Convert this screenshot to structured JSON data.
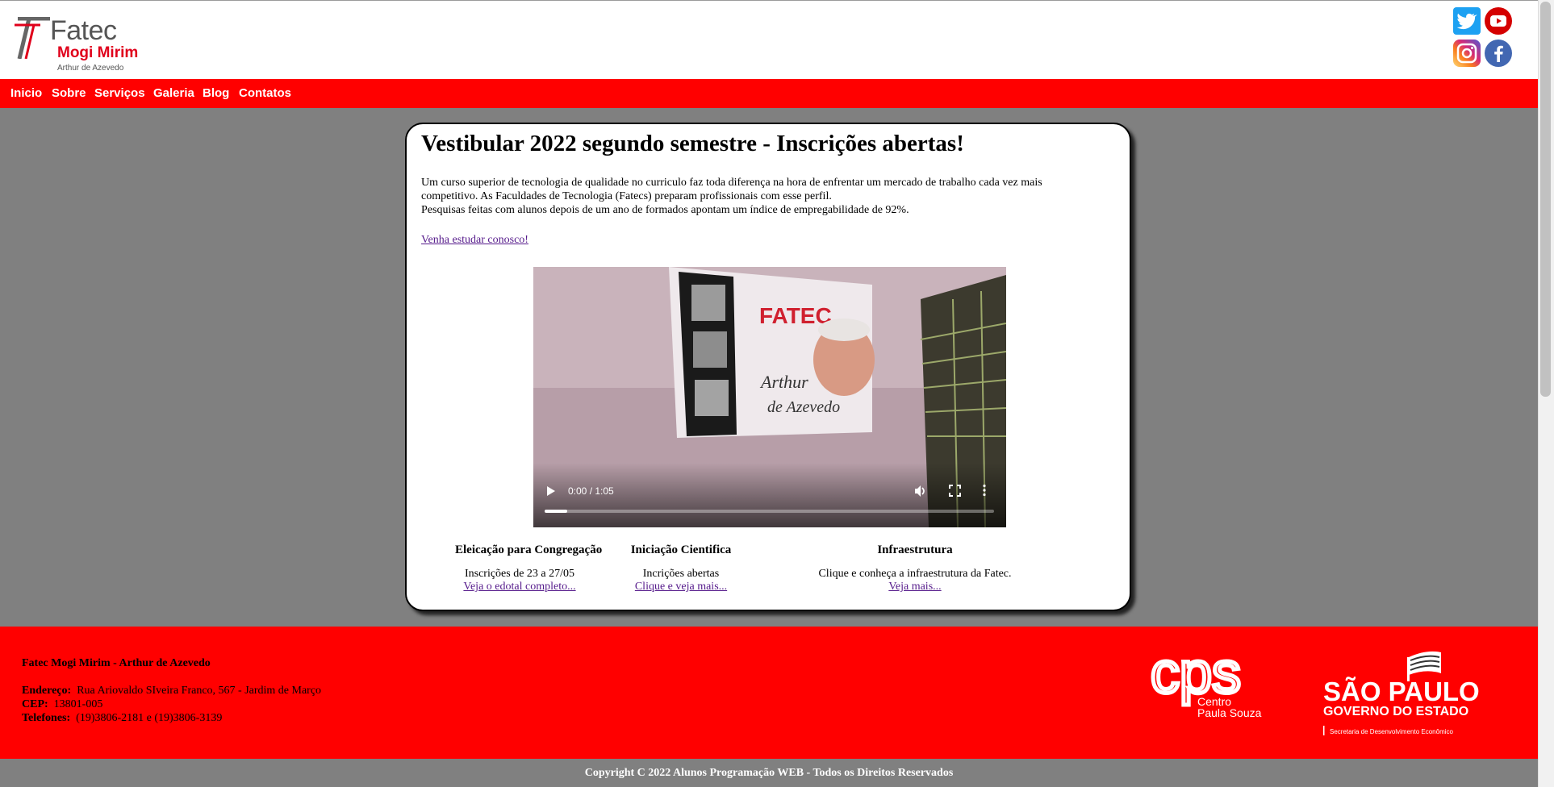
{
  "header": {
    "logo": {
      "title": "Fatec",
      "subtitle": "Mogi Mirim",
      "tagline": "Arthur de Azevedo"
    },
    "social": [
      "twitter-icon",
      "youtube-icon",
      "instagram-icon",
      "facebook-icon"
    ]
  },
  "nav": {
    "items": [
      "Inicio",
      "Sobre",
      "Serviços",
      "Galeria",
      "Blog",
      "Contatos"
    ]
  },
  "main": {
    "title": "Vestibular 2022 segundo semestre - Inscrições abertas!",
    "paragraph1": "Um curso superior de tecnologia de qualidade no curriculo faz toda diferença na hora de enfrentar um mercado de trabalho cada vez mais competitivo. As Faculdades de Tecnologia (Fatecs) preparam profissionais com esse perfil.",
    "paragraph2": "Pesquisas feitas com alunos depois de um ano de formados apontam um índice de empregabilidade de 92%.",
    "link": "Venha estudar conosco!",
    "video": {
      "time": "0:00 / 1:05",
      "progress": 0.05
    },
    "infos": [
      {
        "title": "Eleicação para Congregação",
        "desc": "Inscrições de 23 a 27/05",
        "link": "Veja o edotal completo..."
      },
      {
        "title": "Iniciação Cientifica",
        "desc": "Incrições abertas",
        "link": "Clique e veja mais..."
      },
      {
        "title": "Infraestrutura",
        "desc": "Clique e conheça a infraestrutura da Fatec.",
        "link": "Veja mais..."
      }
    ]
  },
  "footer": {
    "name": "Fatec Mogi Mirim - Arthur de Azevedo",
    "address_label": "Endereço:",
    "address": "Rua Ariovaldo SIveira Franco, 567 - Jardim de Março",
    "cep_label": "CEP:",
    "cep": "13801-005",
    "phone_label": "Telefones:",
    "phone": "(19)3806-2181 e (19)3806-3139",
    "cps_logo": {
      "letters": "cps",
      "line1": "Centro",
      "line2": "Paula Souza"
    },
    "sp_logo": {
      "line1": "SÃO PAULO",
      "line2": "GOVERNO DO ESTADO",
      "line3": "Secretaria de Desenvolvimento Econômico"
    },
    "copyright": "Copyright C 2022 Alunos Programação WEB - Todos os Direitos Reservados"
  },
  "colors": {
    "brand_red": "#ff0000",
    "background_gray": "#808080"
  }
}
